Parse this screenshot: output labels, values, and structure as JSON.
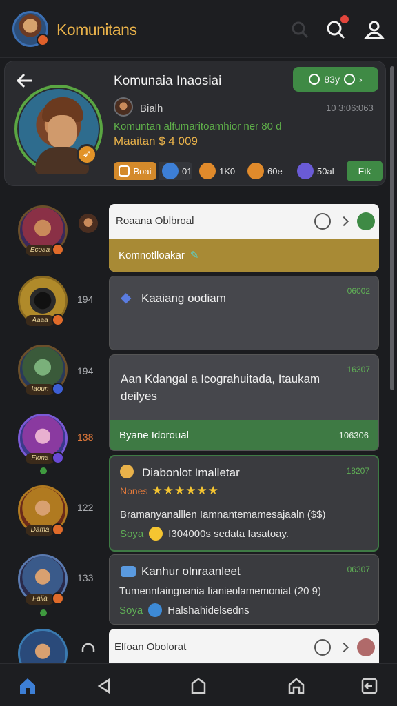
{
  "app": {
    "title": "Komunitans"
  },
  "profile": {
    "title": "Komunaia Inaosiai",
    "status_label": "83y",
    "name": "Bialh",
    "date": "10 3:06:063",
    "description": "Komuntan alfumaritoamhior ner 80 d",
    "balance": "Maaitan $ 4 009",
    "stats": [
      {
        "value": "Boai",
        "icon": "coin-box-icon",
        "color": "#d48a2b"
      },
      {
        "value": "01",
        "icon": "gem-icon",
        "color": "#3d7fd6"
      },
      {
        "value": "1K0",
        "icon": "medal-icon",
        "color": "#e08a2b"
      },
      {
        "value": "60e",
        "icon": "trophy-icon",
        "color": "#e08a2b"
      },
      {
        "value": "50al",
        "icon": "shield-icon",
        "color": "#6a5bd6"
      }
    ],
    "friend_button": "Fik"
  },
  "feed": [
    {
      "count": "",
      "card_title": "Roaana Oblbroal",
      "strip": "Komnotlloakar"
    },
    {
      "count": "194",
      "title": "Kaaiang oodiam",
      "time": "06002"
    },
    {
      "count": "194",
      "body": "Aan Kdangal a Icograhuitada, Itaukam deilyes",
      "time": "16307",
      "strip": "Byane Idoroual",
      "strip_time": "106306"
    },
    {
      "count": "138",
      "title": "Diabonlot Imalletar",
      "subtitle": "Nones",
      "stars": "★★★★★★",
      "body": "Bramanyanalllen Iamnantemamesajaaln ($$)",
      "footer": "Soya",
      "footer_text": "I304000s sedata Iasatoay.",
      "time": "18207"
    },
    {
      "count": "122"
    },
    {
      "count": "133",
      "title": "Kanhur olnraanleet",
      "body": "Tumenntaingnania Iianieolamemoniat (20 9)",
      "footer": "Soya",
      "footer_text": "Halshahidelsedns",
      "time": "06307"
    },
    {
      "count": "",
      "card_title": "Elfoan Obolorat"
    }
  ],
  "rank_badges": [
    "Ecoaa",
    "Aaaa",
    "Iaoun",
    "Fiona",
    "Dama",
    "Faiia"
  ],
  "colors": {
    "accent_green": "#3f8a45",
    "accent_gold": "#e9b24a",
    "background": "#1b1c1f"
  }
}
